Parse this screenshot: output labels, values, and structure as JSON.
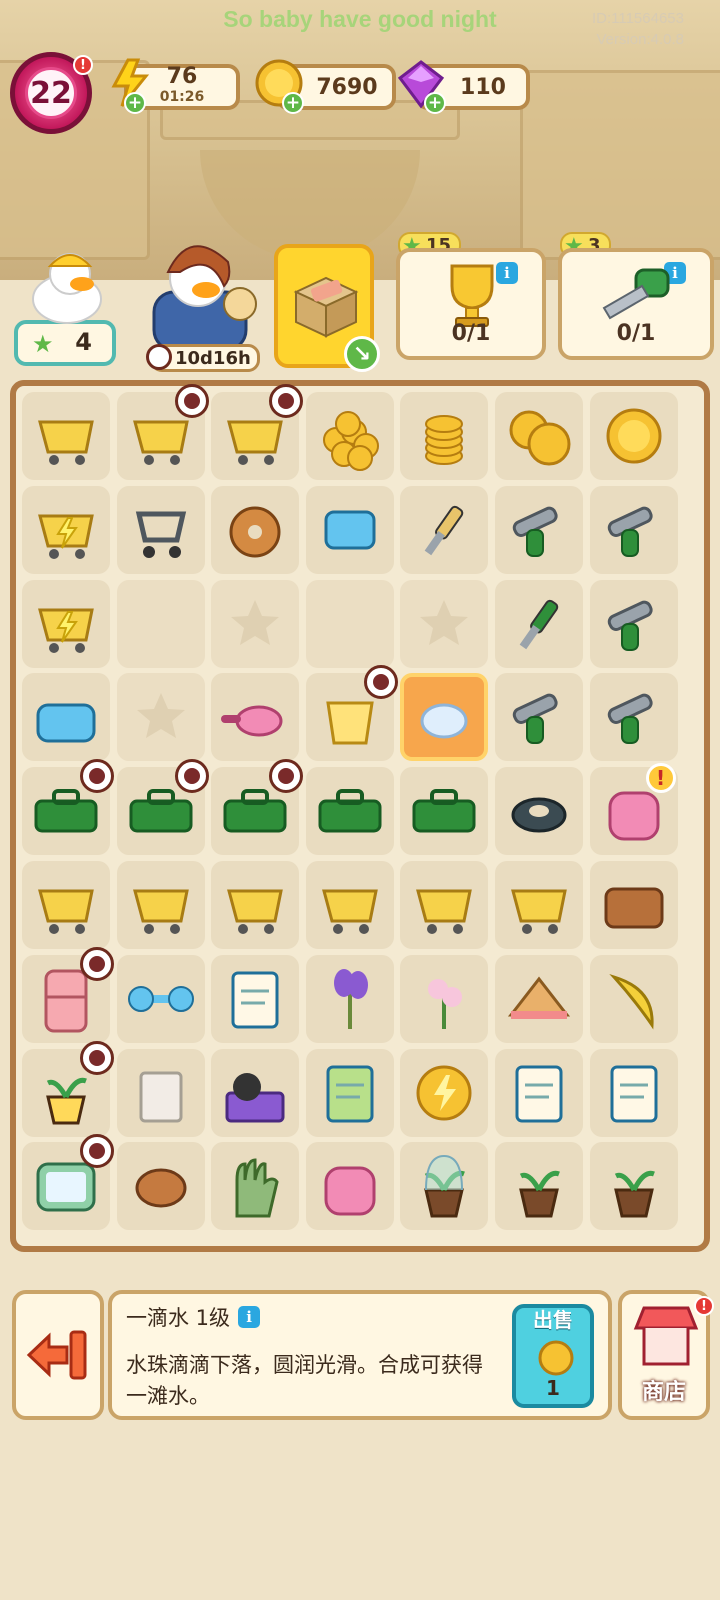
{
  "header": {
    "message": "So baby have good night",
    "id_text": "ID:111564653",
    "version_text": "Version:4.0.8"
  },
  "player": {
    "level": "22"
  },
  "resources": {
    "energy": "76",
    "energy_timer": "01:26",
    "coins": "7690",
    "gems": "110"
  },
  "characters": {
    "worker_stars": "4",
    "painter_timer": "10d16h"
  },
  "orders": [
    {
      "stars": "15",
      "progress": "0/1",
      "icon": "trophy-icon"
    },
    {
      "stars": "3",
      "progress": "0/1",
      "icon": "saw-icon"
    }
  ],
  "board": {
    "rows": [
      [
        "shopping-cart-full",
        "yellow-basket-locked",
        "yellow-basket-locked",
        "coin-pile",
        "coin-stack",
        "coins-two",
        "coin"
      ],
      [
        "shopping-cart-energy",
        "trolley",
        "bagel",
        "chip",
        "trowel",
        "bone-tool",
        "hacksaw"
      ],
      [
        "energy-basket",
        "empty",
        "empty-star",
        "empty",
        "empty-star",
        "screwdriver",
        "pliers"
      ],
      [
        "robot-vacuum",
        "empty-star",
        "saucepan",
        "bucket-locked",
        "water-drop-selected",
        "paint-roller",
        "wrench"
      ],
      [
        "toolbox-open-locked",
        "toolbox-tools-locked",
        "toolbox-tray-locked",
        "toolbox-closed",
        "toolbox-flat",
        "tape-roll",
        "backpack"
      ],
      [
        "basket-cart",
        "basket-weight",
        "basket-empty",
        "basket-frame",
        "basket-thin",
        "milk-carton",
        "wallet"
      ],
      [
        "fridge-locked",
        "dumbbell",
        "report",
        "lavender",
        "flower-bouquet",
        "sandwich",
        "banana-peel"
      ],
      [
        "sprout-pot-locked",
        "paper-bag",
        "weight-crate",
        "seed-packet",
        "energy-coin",
        "notebook",
        "chart-notepad"
      ],
      [
        "tv-locked",
        "potato",
        "glove",
        "pink-bag",
        "terrarium",
        "small-plant",
        "potted-plant"
      ]
    ]
  },
  "detail": {
    "title": "一滴水 1级",
    "description": "水珠滴滴下落，圆润光滑。合成可获得一滩水。",
    "sell_label": "出售",
    "sell_price": "1"
  },
  "shop_label": "商店",
  "colors": {
    "board_border": "#b07a45",
    "selected_cell": "#f7a64c",
    "accent_green": "#5fb848",
    "sell_teal": "#4fd0e0"
  }
}
